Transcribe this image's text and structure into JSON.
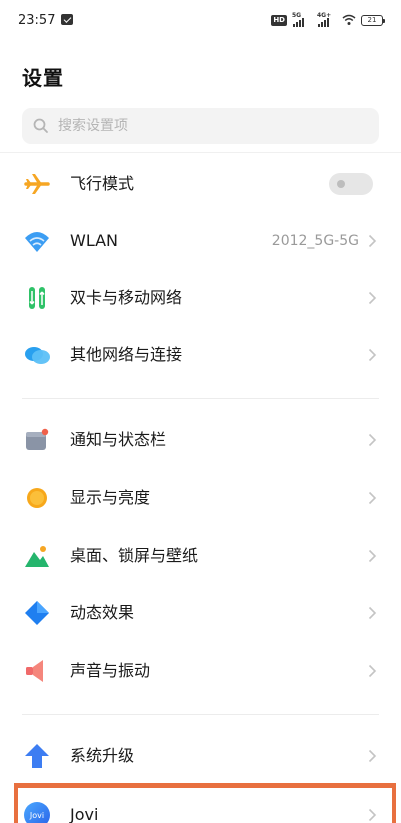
{
  "status_bar": {
    "time": "23:57",
    "hd": "HD",
    "sim1_tag": "5G",
    "sim2_tag": "4G+",
    "battery": "21"
  },
  "page": {
    "title": "设置"
  },
  "search": {
    "placeholder": "搜索设置项"
  },
  "colors": {
    "highlight_border": "#e8703f",
    "toggle_off": "#e6e6e6"
  },
  "items": [
    {
      "label": "飞行模式",
      "icon": "airplane-icon",
      "control": "toggle",
      "toggle_on": false
    },
    {
      "label": "WLAN",
      "icon": "wifi-icon",
      "value": "2012_5G-5G"
    },
    {
      "label": "双卡与移动网络",
      "icon": "dual-sim-icon"
    },
    {
      "label": "其他网络与连接",
      "icon": "other-network-icon"
    },
    {
      "label": "通知与状态栏",
      "icon": "notification-icon"
    },
    {
      "label": "显示与亮度",
      "icon": "display-brightness-icon"
    },
    {
      "label": "桌面、锁屏与壁纸",
      "icon": "wallpaper-icon"
    },
    {
      "label": "动态效果",
      "icon": "dynamic-effect-icon"
    },
    {
      "label": "声音与振动",
      "icon": "sound-icon"
    },
    {
      "label": "系统升级",
      "icon": "system-upgrade-icon"
    },
    {
      "label": "Jovi",
      "icon": "jovi-icon",
      "icon_text": "Jovi"
    }
  ]
}
